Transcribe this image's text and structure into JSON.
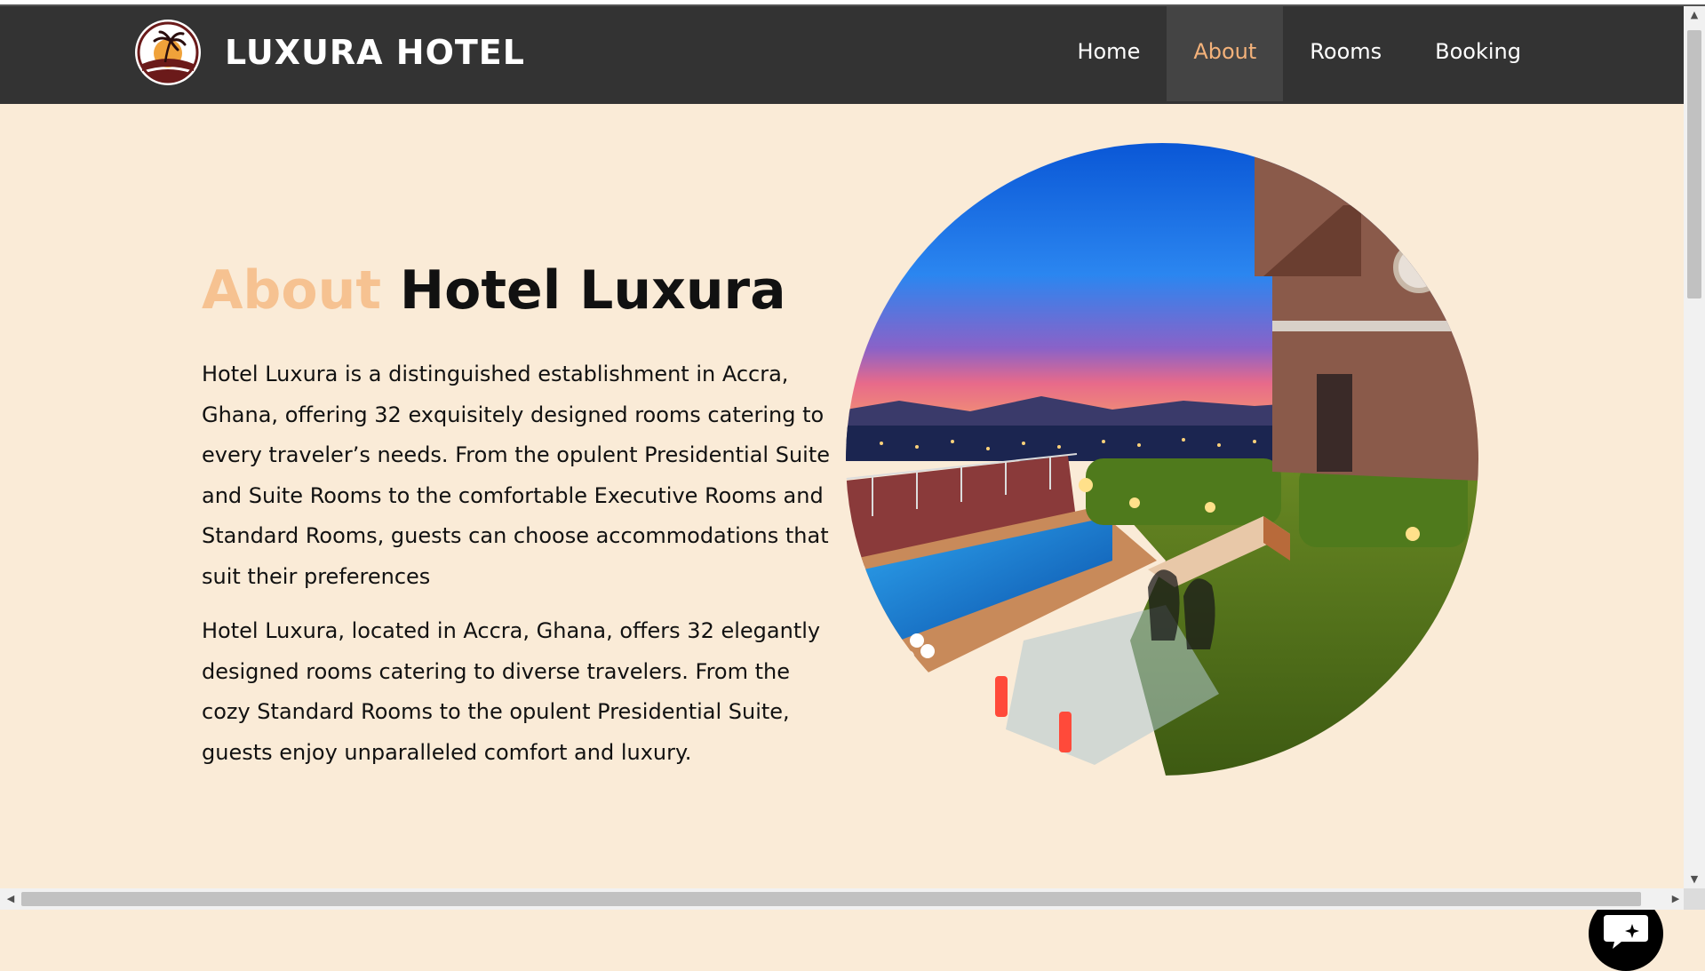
{
  "brand": {
    "name": "LUXURA HOTEL",
    "logo_icon": "palm-sunset-logo"
  },
  "nav": {
    "items": [
      {
        "label": "Home",
        "active": false
      },
      {
        "label": "About",
        "active": true
      },
      {
        "label": "Rooms",
        "active": false
      },
      {
        "label": "Booking",
        "active": false
      }
    ]
  },
  "about": {
    "heading_accent": "About",
    "heading_rest": "Hotel Luxura",
    "paragraphs": [
      "Hotel Luxura is a distinguished establishment in Accra, Ghana, offering 32 exquisitely designed rooms catering to every traveler’s needs. From the opulent Presidential Suite and Suite Rooms to the comfortable Executive Rooms and Standard Rooms, guests can choose accommodations that suit their preferences",
      "Hotel Luxura, located in Accra, Ghana, offers 32 elegantly designed rooms catering to diverse travelers. From the cozy Standard Rooms to the opulent Presidential Suite, guests enjoy unparalleled comfort and luxury."
    ],
    "image_icon": "hotel-pool-terrace-photo"
  },
  "chat": {
    "icon": "chat-sparkle-icon"
  },
  "colors": {
    "navbar": "#333333",
    "accent": "#f4b27a",
    "heading_accent": "#f6c291",
    "background": "#faebd7",
    "nav_active_bg": "#444444"
  }
}
